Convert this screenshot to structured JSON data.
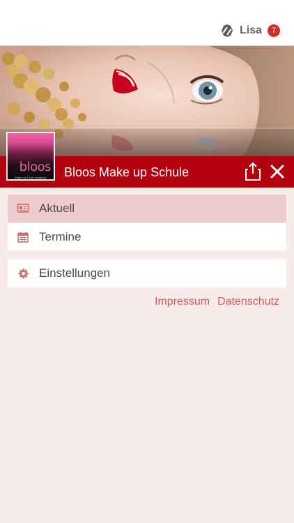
{
  "header": {
    "brand_icon": "brand-logo-icon",
    "user_name": "Lisa",
    "notification_count": "7"
  },
  "profile": {
    "title": "Bloos Make up Schule",
    "logo_word": "bloos",
    "logo_tagline": "Make up & Hair Academy"
  },
  "actions": {
    "share_icon": "share-icon",
    "close_icon": "close-icon"
  },
  "menu": {
    "groups": [
      {
        "items": [
          {
            "label": "Aktuell",
            "icon": "newspaper-icon",
            "active": true
          },
          {
            "label": "Termine",
            "icon": "calendar-icon",
            "active": false
          }
        ]
      },
      {
        "items": [
          {
            "label": "Einstellungen",
            "icon": "gear-icon",
            "active": false
          }
        ]
      }
    ]
  },
  "footer_links": [
    "Impressum",
    "Datenschutz"
  ],
  "colors": {
    "accent": "#b3000f",
    "badge": "#d92b2b",
    "page_background": "#f8eceb",
    "active_item": "#efcccc",
    "link": "#c75d5d"
  }
}
